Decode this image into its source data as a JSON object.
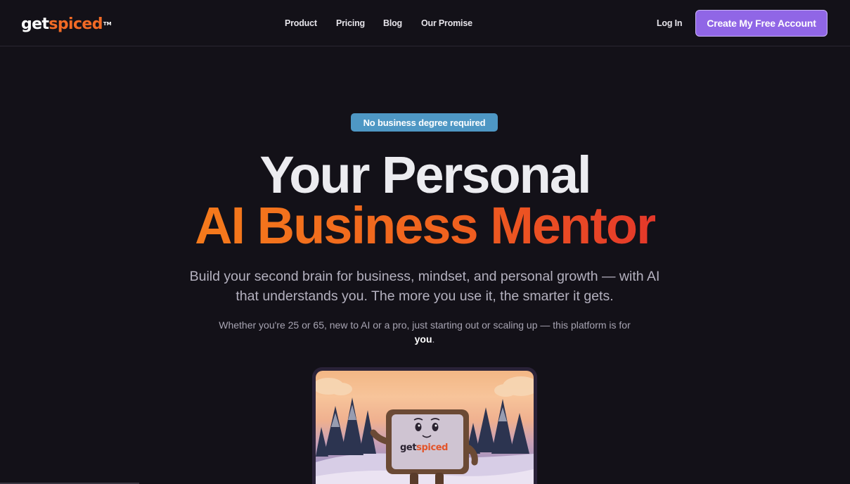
{
  "nav": {
    "logo": {
      "get": "get",
      "spiced": "spiced",
      "tm": "TM"
    },
    "links": [
      "Product",
      "Pricing",
      "Blog",
      "Our Promise"
    ],
    "login": "Log In",
    "cta": "Create My Free Account"
  },
  "hero": {
    "badge": "No business degree required",
    "headline_line1": "Your Personal",
    "headline_line2": "AI Business Mentor",
    "subtitle": "Build your second brain for business, mindset, and personal growth — with AI that understands you. The more you use it, the smarter it gets.",
    "note_prefix": "Whether you're 25 or 65, new to AI or a pro, just starting out or scaling up — this platform is for ",
    "note_emphasis": "you",
    "note_suffix": ".",
    "image_logo": {
      "get": "get",
      "spiced": "spiced"
    }
  },
  "colors": {
    "background": "#131118",
    "accent_orange": "#f06a1e",
    "cta_purple": "#9066e6",
    "badge_blue": "#4e97c4"
  },
  "icons": {
    "hero_image": "mascot-illustration"
  }
}
